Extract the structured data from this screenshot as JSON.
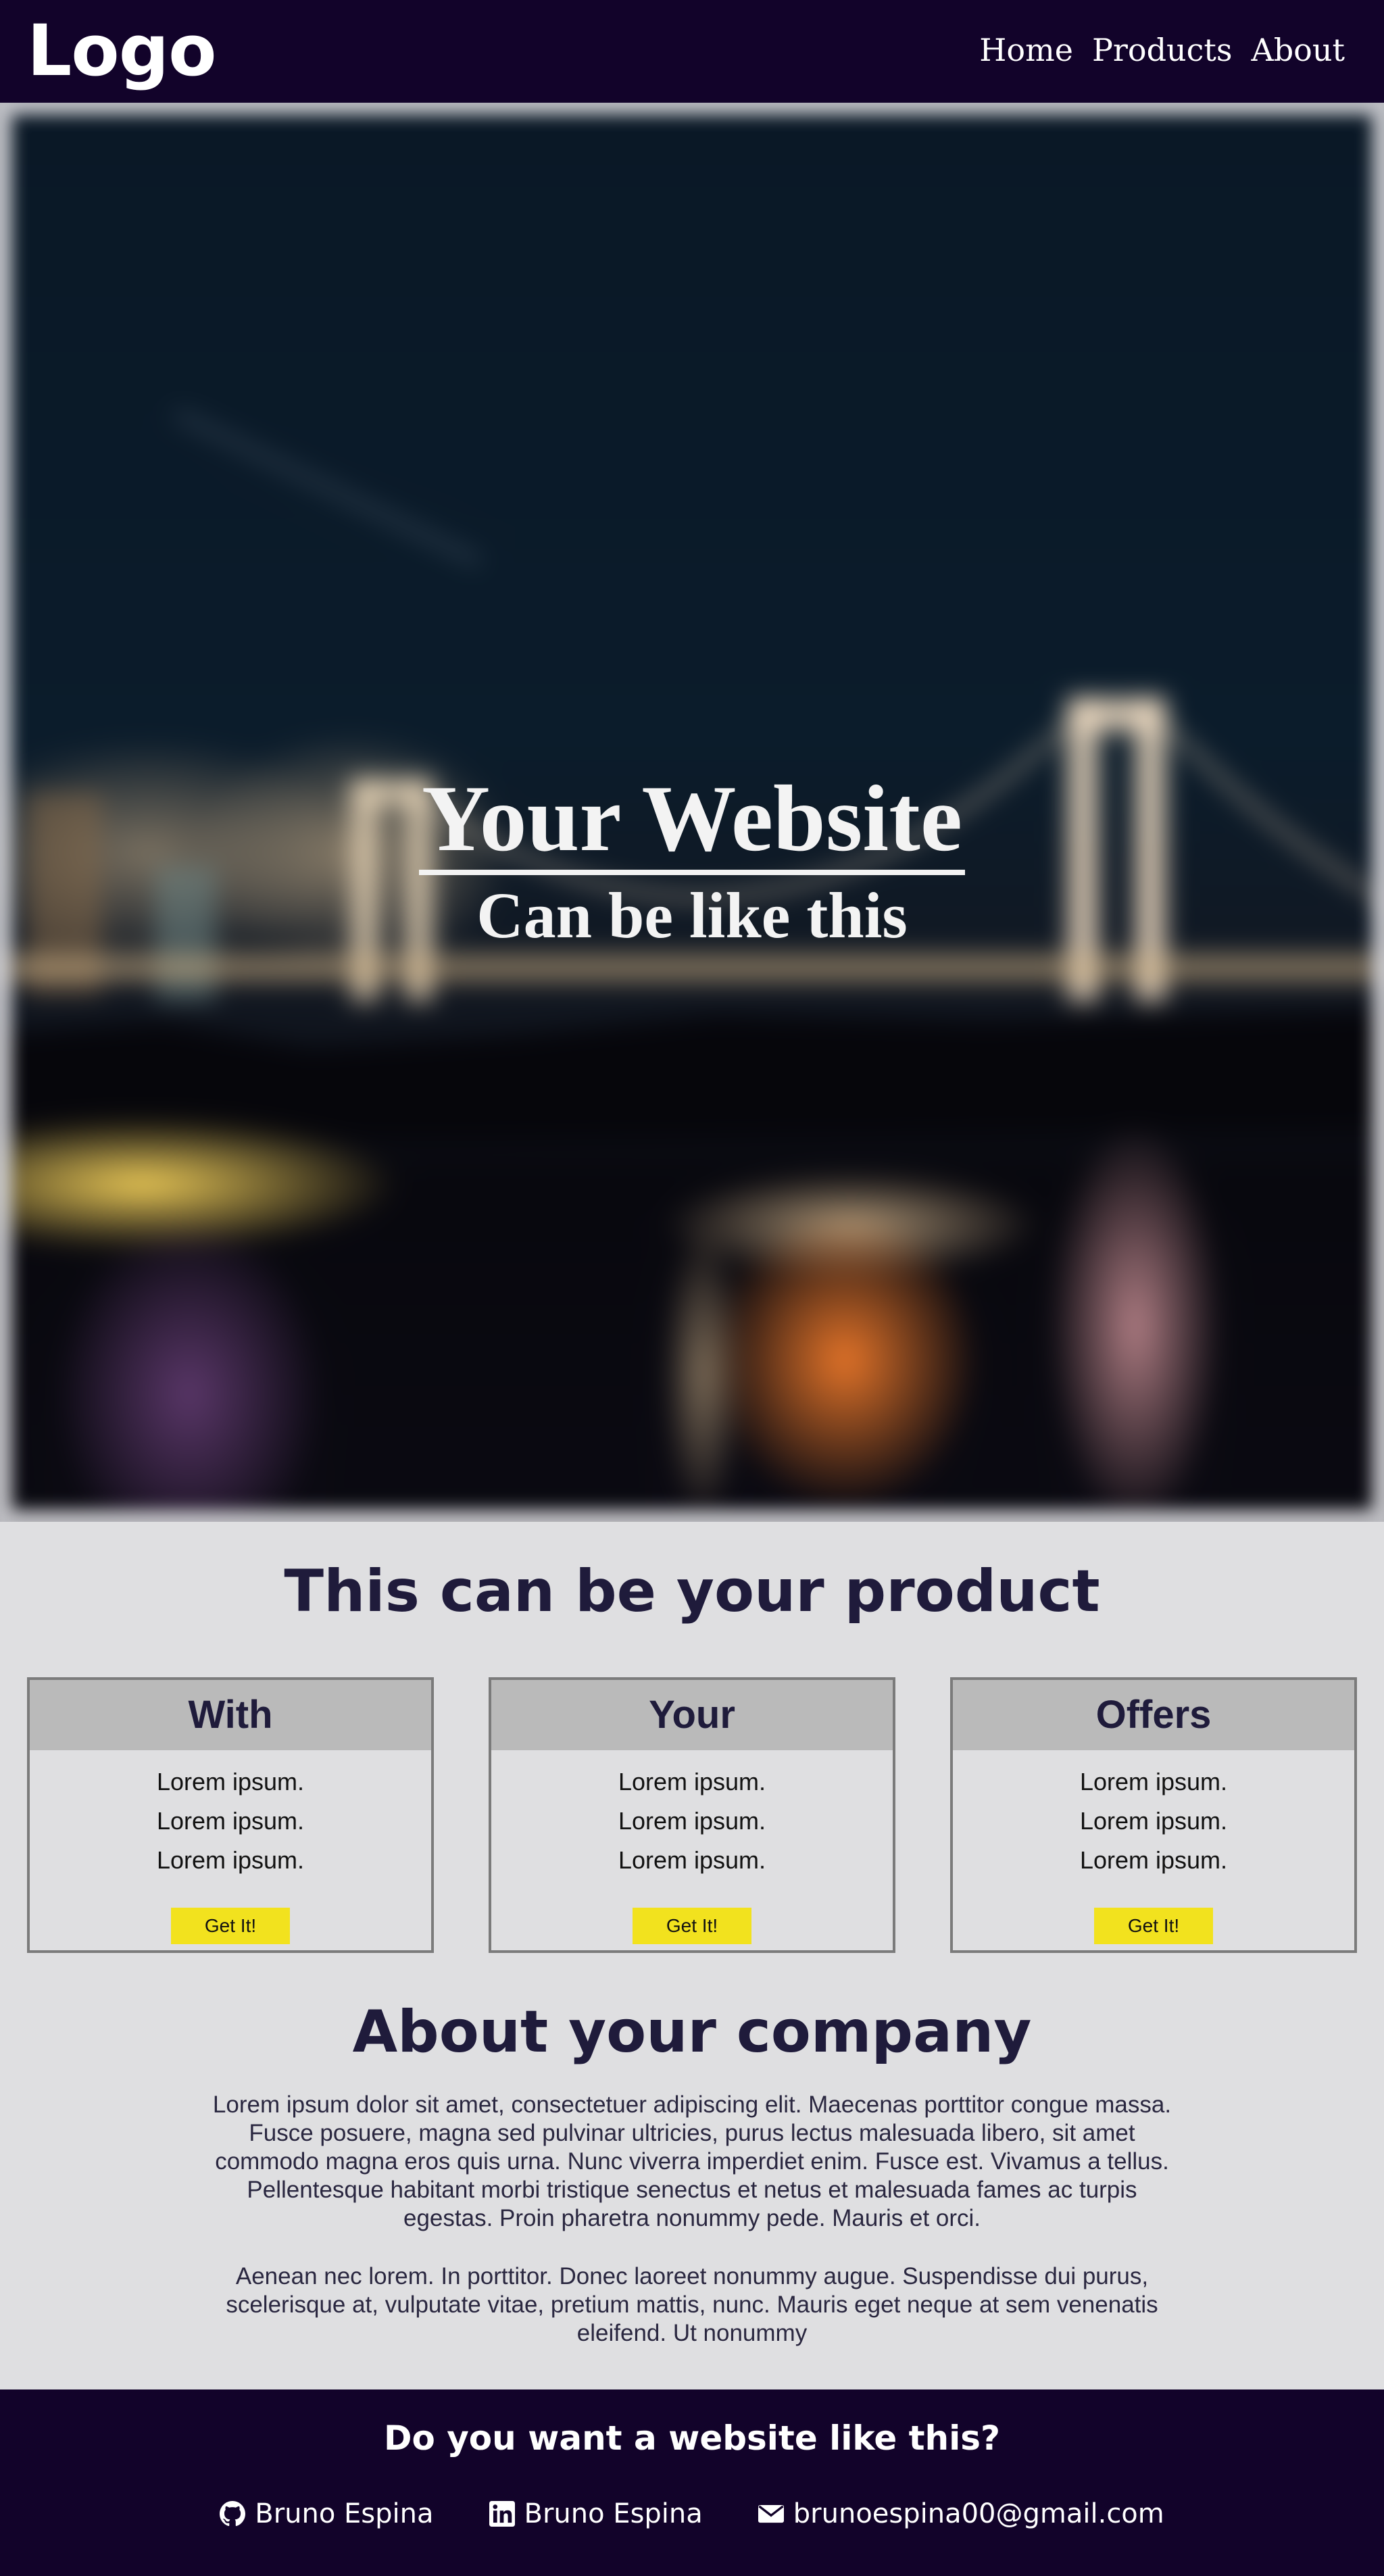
{
  "navbar": {
    "logo": "Logo",
    "links": [
      "Home",
      "Products",
      "About"
    ]
  },
  "hero": {
    "title": "Your Website",
    "subtitle": "Can be like this"
  },
  "products": {
    "title": "This can be your product",
    "cards": [
      {
        "heading": "With",
        "items": [
          "Lorem ipsum.",
          "Lorem ipsum.",
          "Lorem ipsum."
        ],
        "button": "Get It!"
      },
      {
        "heading": "Your",
        "items": [
          "Lorem ipsum.",
          "Lorem ipsum.",
          "Lorem ipsum."
        ],
        "button": "Get It!"
      },
      {
        "heading": "Offers",
        "items": [
          "Lorem ipsum.",
          "Lorem ipsum.",
          "Lorem ipsum."
        ],
        "button": "Get It!"
      }
    ]
  },
  "about": {
    "title": "About your company",
    "paragraphs": [
      "Lorem ipsum dolor sit amet, consectetuer adipiscing elit. Maecenas porttitor congue massa. Fusce posuere, magna sed pulvinar ultricies, purus lectus malesuada libero, sit amet commodo magna eros quis urna. Nunc viverra imperdiet enim. Fusce est. Vivamus a tellus. Pellentesque habitant morbi tristique senectus et netus et malesuada fames ac turpis egestas. Proin pharetra nonummy pede. Mauris et orci.",
      "Aenean nec lorem. In porttitor. Donec laoreet nonummy augue. Suspendisse dui purus, scelerisque at, vulputate vitae, pretium mattis, nunc. Mauris eget neque at sem venenatis eleifend. Ut nonummy"
    ]
  },
  "footer": {
    "title": "Do you want a website like this?",
    "contacts": [
      {
        "icon": "github-icon",
        "label": "Bruno Espina"
      },
      {
        "icon": "linkedin-icon",
        "label": "Bruno Espina"
      },
      {
        "icon": "envelope-icon",
        "label": "brunoespina00@gmail.com"
      }
    ]
  },
  "colors": {
    "navbar_bg": "#12032a",
    "page_bg": "#dfdfe1",
    "heading_text": "#1f1b3b",
    "card_header_bg": "#bababa",
    "button_bg": "#f2e21e"
  }
}
